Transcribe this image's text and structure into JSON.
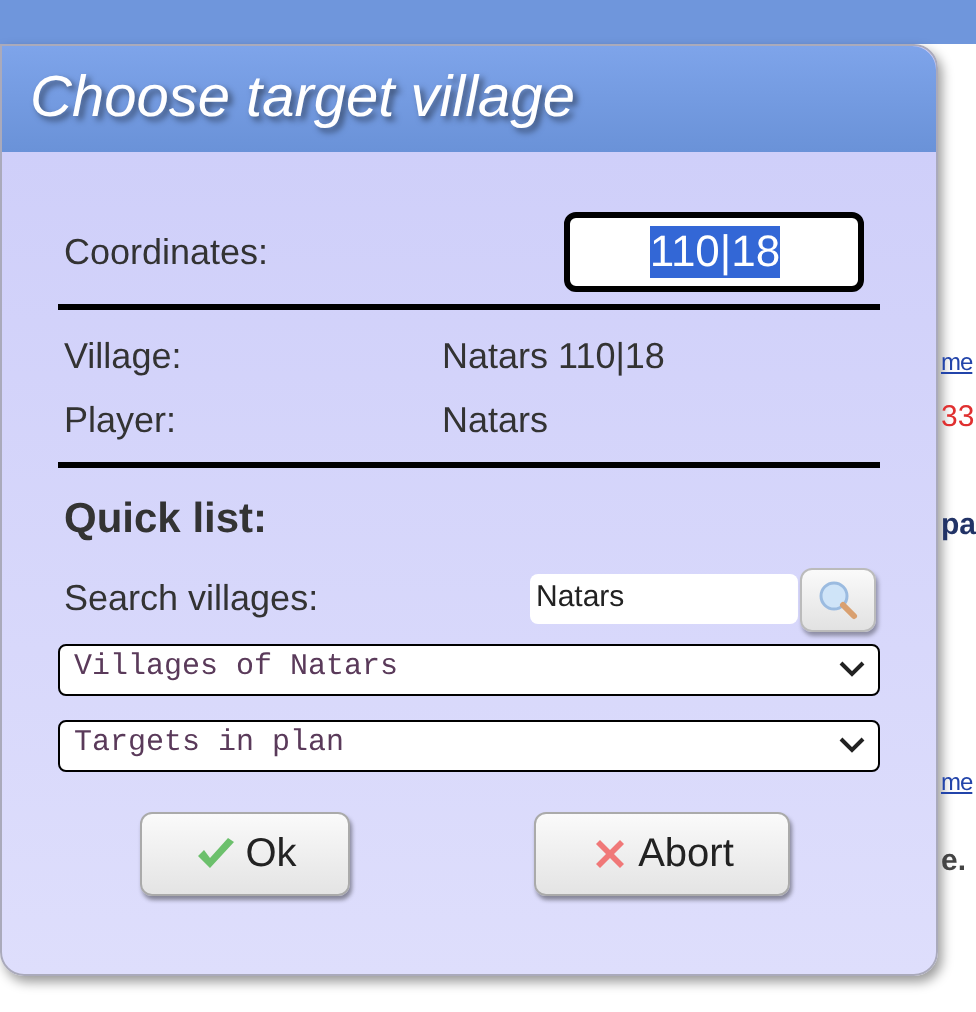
{
  "dialog": {
    "title": "Choose target village",
    "coordinates": {
      "label": "Coordinates:",
      "value": "110|18"
    },
    "village": {
      "label": "Village:",
      "value": "Natars 110|18"
    },
    "player": {
      "label": "Player:",
      "value": "Natars"
    },
    "quick_list": {
      "heading": "Quick list:",
      "search_label": "Search villages:",
      "search_value": "Natars",
      "selects": [
        {
          "value": "Villages of Natars"
        },
        {
          "value": "Targets in plan"
        }
      ]
    },
    "buttons": [
      {
        "kind": "ok",
        "label": "Ok"
      },
      {
        "kind": "abort",
        "label": "Abort"
      }
    ]
  },
  "background_fragments": [
    {
      "kind": "link",
      "text": "me"
    },
    {
      "kind": "red",
      "text": "33"
    },
    {
      "kind": "bold",
      "text": "pa"
    },
    {
      "kind": "link",
      "text": "me"
    },
    {
      "kind": "plain",
      "text": "e."
    }
  ]
}
